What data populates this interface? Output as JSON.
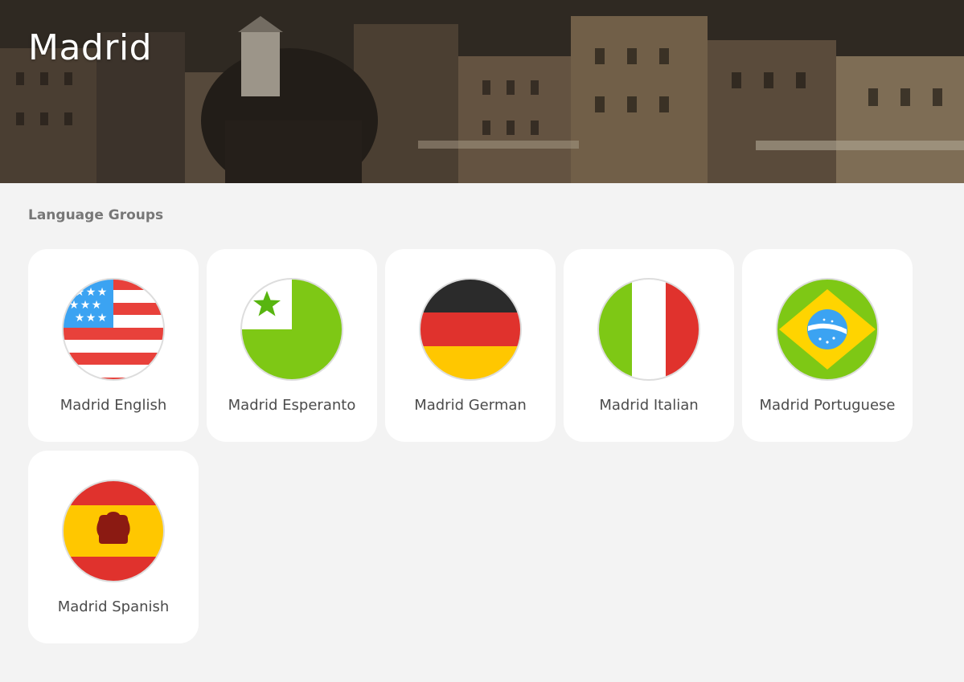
{
  "hero": {
    "title": "Madrid"
  },
  "section": {
    "title": "Language Groups"
  },
  "groups": [
    {
      "label": "Madrid English",
      "flag": "us-flag-icon"
    },
    {
      "label": "Madrid Esperanto",
      "flag": "esperanto-flag-icon"
    },
    {
      "label": "Madrid German",
      "flag": "germany-flag-icon"
    },
    {
      "label": "Madrid Italian",
      "flag": "italy-flag-icon"
    },
    {
      "label": "Madrid Portuguese",
      "flag": "brazil-flag-icon"
    },
    {
      "label": "Madrid Spanish",
      "flag": "spain-flag-icon"
    }
  ],
  "colors": {
    "page_background": "#f3f3f3",
    "card_background": "#ffffff",
    "label_text": "#4b4b4b",
    "section_title_text": "#777777"
  }
}
